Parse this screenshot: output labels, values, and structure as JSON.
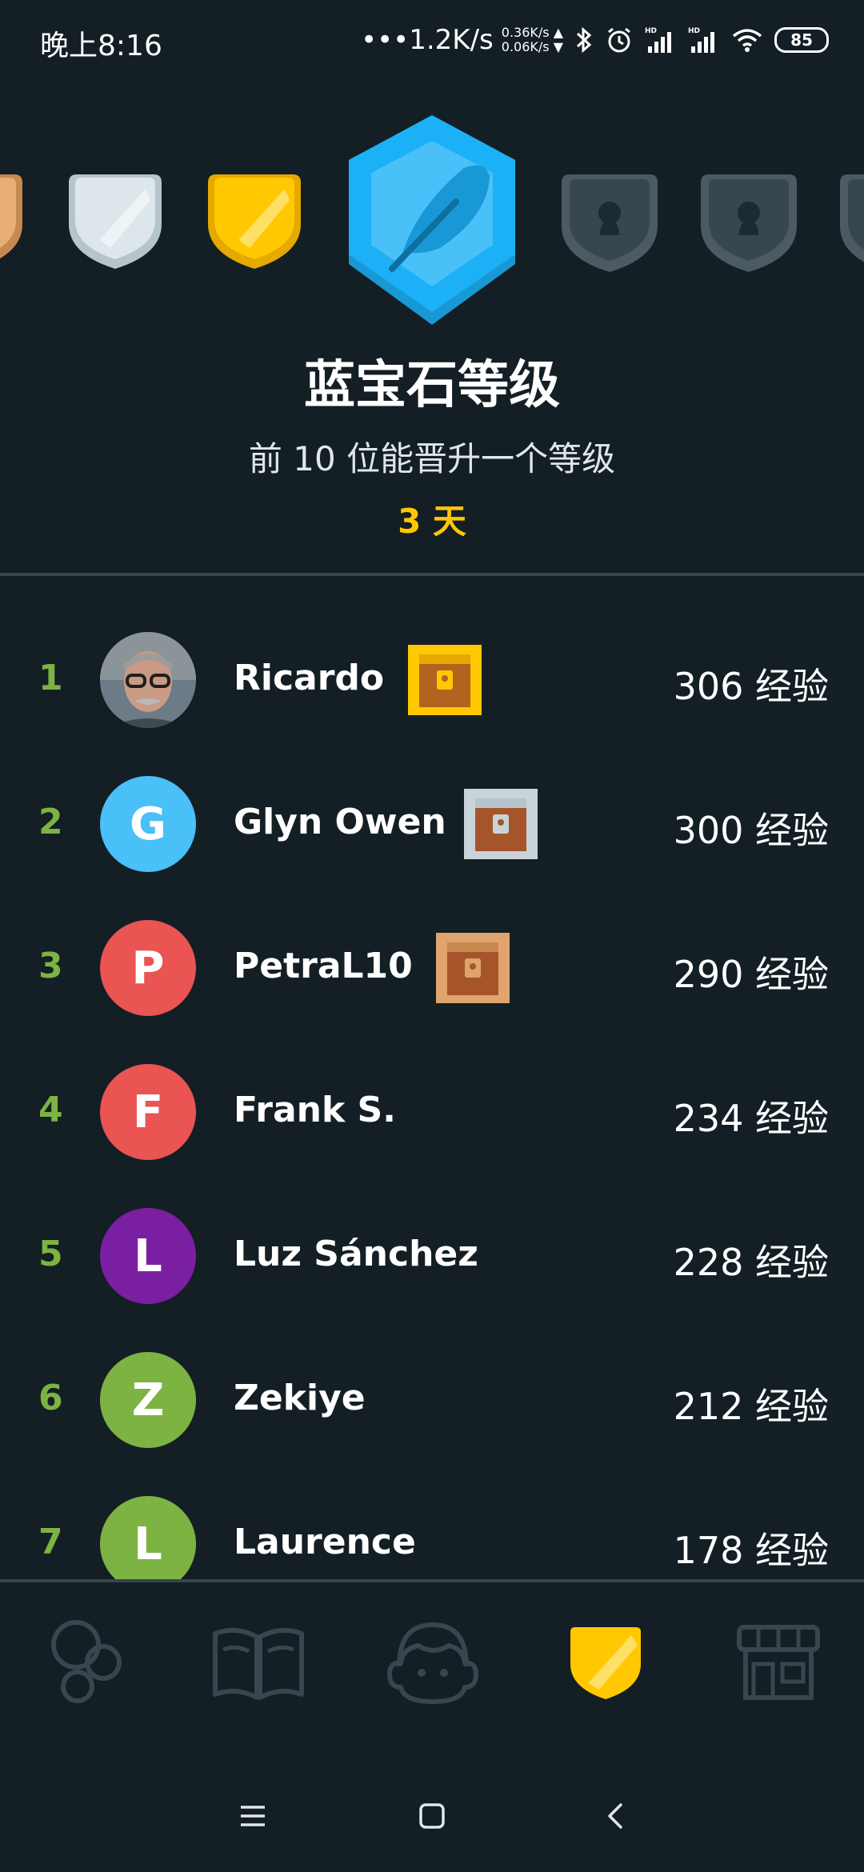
{
  "status_bar": {
    "time": "晚上8:16",
    "net_speed": "•••1.2K/s",
    "up_speed": "0.36K/s ▲",
    "down_speed": "0.06K/s ▼",
    "battery": "85"
  },
  "league": {
    "title": "蓝宝石等级",
    "subtitle": "前 10 位能晋升一个等级",
    "days_left": "3 天"
  },
  "leaderboard": [
    {
      "rank": "1",
      "name": "Ricardo",
      "initial": "",
      "avatar_color": "#6d7b86",
      "chest": "gold",
      "xp": "306 经验"
    },
    {
      "rank": "2",
      "name": "Glyn Owen",
      "initial": "G",
      "avatar_color": "#49c0f8",
      "chest": "silver",
      "xp": "300 经验"
    },
    {
      "rank": "3",
      "name": "PetraL10",
      "initial": "P",
      "avatar_color": "#ea5453",
      "chest": "bronze",
      "xp": "290 经验"
    },
    {
      "rank": "4",
      "name": "Frank S.",
      "initial": "F",
      "avatar_color": "#ea5453",
      "chest": "",
      "xp": "234 经验"
    },
    {
      "rank": "5",
      "name": "Luz Sánchez",
      "initial": "L",
      "avatar_color": "#7b1fa2",
      "chest": "",
      "xp": "228 经验"
    },
    {
      "rank": "6",
      "name": "Zekiye",
      "initial": "Z",
      "avatar_color": "#7cb342",
      "chest": "",
      "xp": "212 经验"
    },
    {
      "rank": "7",
      "name": "Laurence",
      "initial": "L",
      "avatar_color": "#7cb342",
      "chest": "",
      "xp": "178 经验"
    }
  ],
  "tabs": [
    {
      "icon": "skills-circles-icon",
      "active": false
    },
    {
      "icon": "book-icon",
      "active": false
    },
    {
      "icon": "character-face-icon",
      "active": false
    },
    {
      "icon": "league-shield-icon",
      "active": true
    },
    {
      "icon": "shop-icon",
      "active": false
    }
  ],
  "colors": {
    "background": "#131f24",
    "rank_green": "#7cb342",
    "gold": "#ffc800",
    "sapphire": "#1cb0f6",
    "divider": "#37464f"
  }
}
